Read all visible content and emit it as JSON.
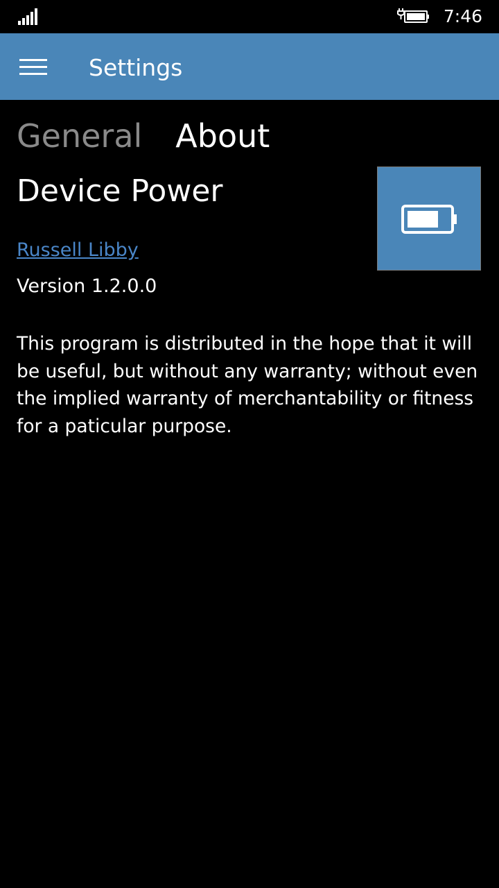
{
  "status_bar": {
    "time": "7:46",
    "signal_icon": "signal-strength-icon",
    "battery_icon": "battery-charging-icon"
  },
  "app_bar": {
    "menu_icon": "hamburger-menu-icon",
    "title": "Settings",
    "background_color": "#4a86b8"
  },
  "pivot": {
    "tabs": [
      {
        "label": "General",
        "selected": false
      },
      {
        "label": "About",
        "selected": true
      }
    ]
  },
  "about": {
    "app_name": "Device Power",
    "tile_icon": "battery-icon",
    "author": "Russell Libby",
    "version": "Version 1.2.0.0",
    "disclaimer": "This program is distributed in the hope that it will be useful, but without any warranty; without even the implied warranty of merchantability or fitness for a paticular purpose."
  }
}
